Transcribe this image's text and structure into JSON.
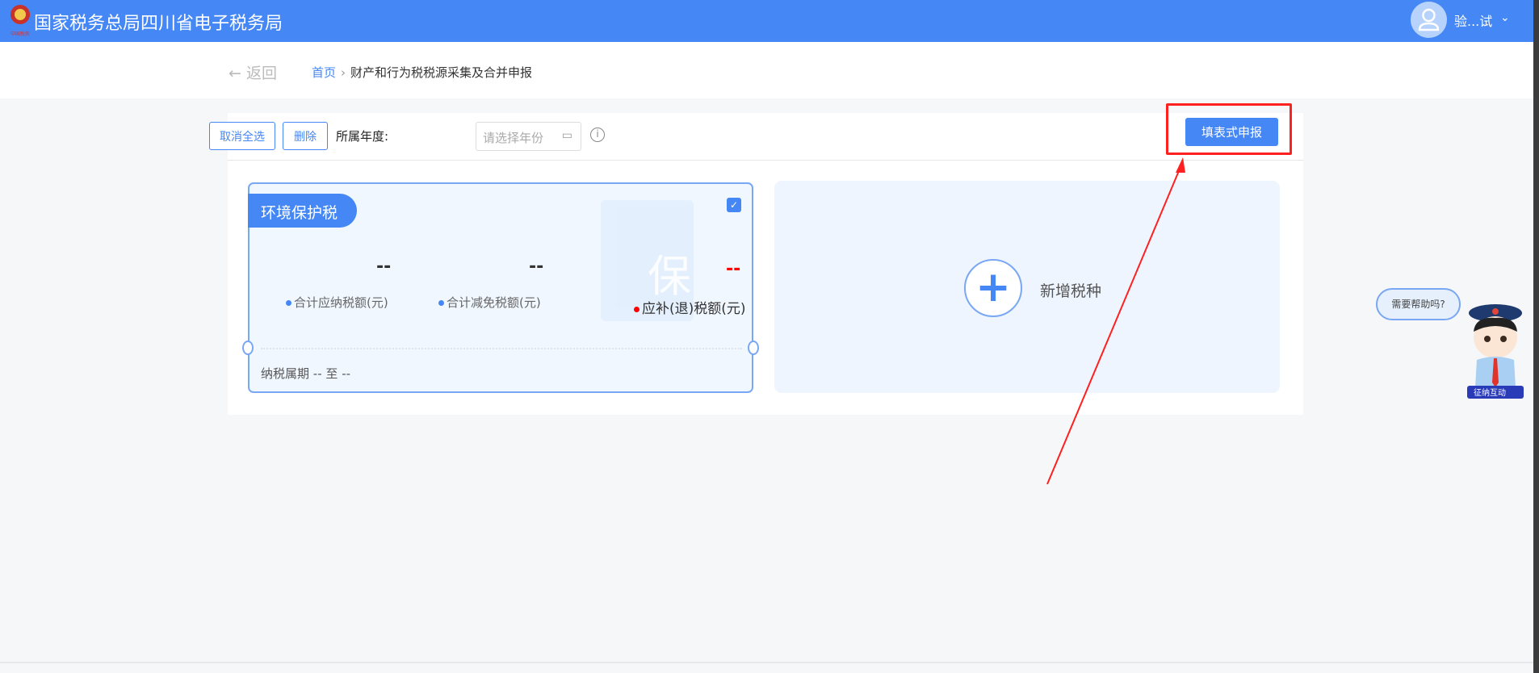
{
  "header": {
    "title": "国家税务总局四川省电子税务局",
    "logo_text": "中国税务",
    "username": "验...试"
  },
  "breadcrumb": {
    "back": "返回",
    "home": "首页",
    "separator": "›",
    "current": "财产和行为税税源采集及合并申报"
  },
  "toolbar": {
    "cancel_select_all": "取消全选",
    "delete": "删除",
    "year_label": "所属年度:",
    "year_placeholder": "请选择年份",
    "fill_report": "填表式申报"
  },
  "card": {
    "tax_name": "环境保护税",
    "checked": true,
    "watermark": "保",
    "metrics": [
      {
        "value": "--",
        "label": "合计应纳税额(元)"
      },
      {
        "value": "--",
        "label": "合计减免税额(元)"
      },
      {
        "value": "--",
        "label": "应补(退)税额(元)"
      }
    ],
    "period_label": "纳税属期",
    "period_from": "--",
    "period_to_word": "至",
    "period_to": "--"
  },
  "add_card": {
    "label": "新增税种"
  },
  "help": {
    "bubble": "需要帮助吗?",
    "badge": "征纳互动"
  },
  "colors": {
    "brand": "#4487f5",
    "highlight": "#ff2020"
  }
}
